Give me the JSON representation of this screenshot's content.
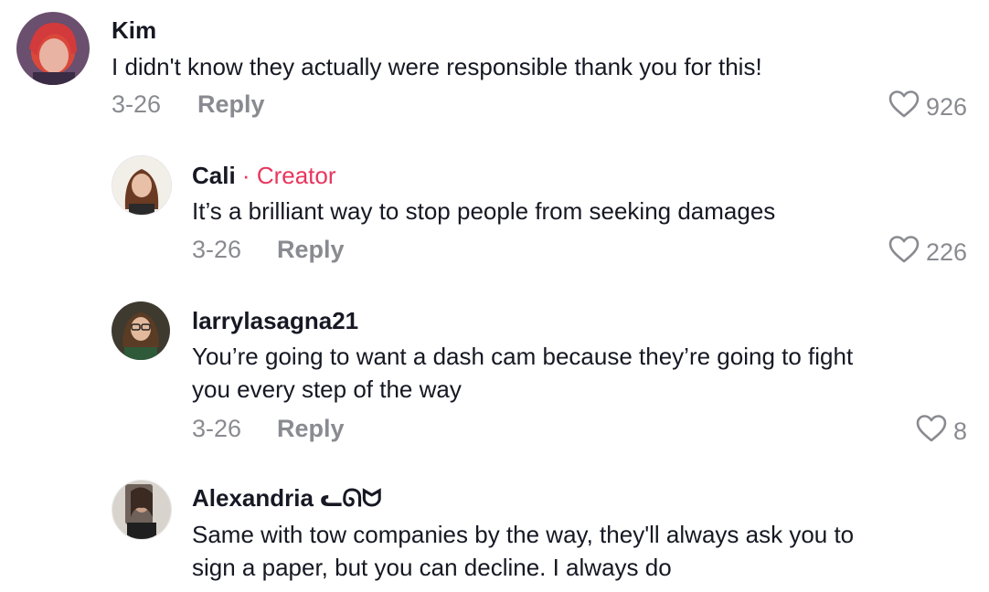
{
  "comments": [
    {
      "username": "Kim",
      "text_lines": [
        "I didn't know they actually were responsible thank you for this!"
      ],
      "date": "3-26",
      "reply_label": "Reply",
      "likes": "926"
    },
    {
      "username": "Cali",
      "badge_separator": "·",
      "badge": "Creator",
      "text_lines": [
        "It’s a brilliant way to stop people from seeking damages"
      ],
      "date": "3-26",
      "reply_label": "Reply",
      "likes": "226"
    },
    {
      "username": "larrylasagna21",
      "text_lines": [
        "You’re going to want a dash cam because they’re going to fight",
        "you every step of the way"
      ],
      "date": "3-26",
      "reply_label": "Reply",
      "likes": "8"
    },
    {
      "username": "Alexandria ᓚᘏᗢ",
      "text_lines": [
        "Same with tow companies by the way, they'll always ask you to",
        "sign a paper, but you can decline. I always do"
      ]
    }
  ],
  "colors": {
    "text": "#161823",
    "secondary": "#8a8b91",
    "creator": "#e8365d"
  },
  "icons": {
    "like": "heart-outline-icon"
  }
}
